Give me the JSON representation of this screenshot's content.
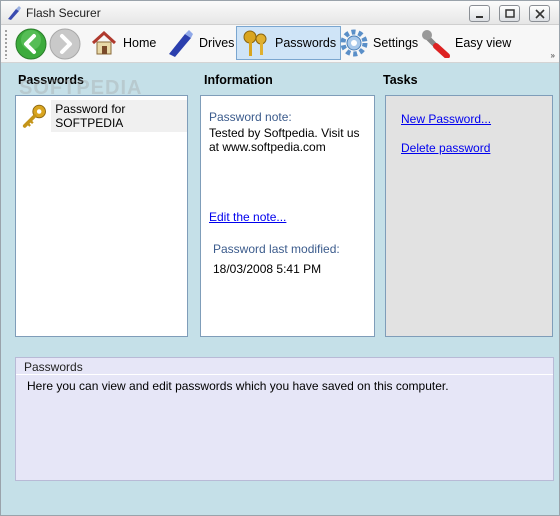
{
  "window": {
    "title": "Flash Securer"
  },
  "toolbar": {
    "items": [
      {
        "label": "Home",
        "icon": "home-icon"
      },
      {
        "label": "Drives",
        "icon": "drive-icon"
      },
      {
        "label": "Passwords",
        "icon": "keys-icon",
        "active": true
      },
      {
        "label": "Settings",
        "icon": "gear-icon"
      },
      {
        "label": "Easy view",
        "icon": "wrench-icon"
      }
    ],
    "overflow": "»"
  },
  "sections": {
    "passwords_header": "Passwords",
    "info_header": "Information",
    "tasks_header": "Tasks"
  },
  "passwords": {
    "items": [
      {
        "label": "Password for SOFTPEDIA",
        "icon": "key-icon"
      }
    ]
  },
  "information": {
    "note_label": "Password note:",
    "note_text": "Tested by Softpedia. Visit us at www.softpedia.com",
    "edit_link": "Edit the note...",
    "modified_label": "Password last modified:",
    "modified_value": "18/03/2008 5:41 PM"
  },
  "tasks": {
    "new_password": "New Password...",
    "delete_password": "Delete password"
  },
  "description": {
    "title": "Passwords",
    "text": "Here you can view and edit passwords which you have saved on this computer."
  },
  "watermark": "SOFTPEDIA",
  "colors": {
    "window_bg": "#c5e0e8",
    "link": "#0000ee",
    "active_tab": "#cfe4f7",
    "desc_bg": "#e6e6f7",
    "tasks_bg": "#e2e2e2"
  }
}
